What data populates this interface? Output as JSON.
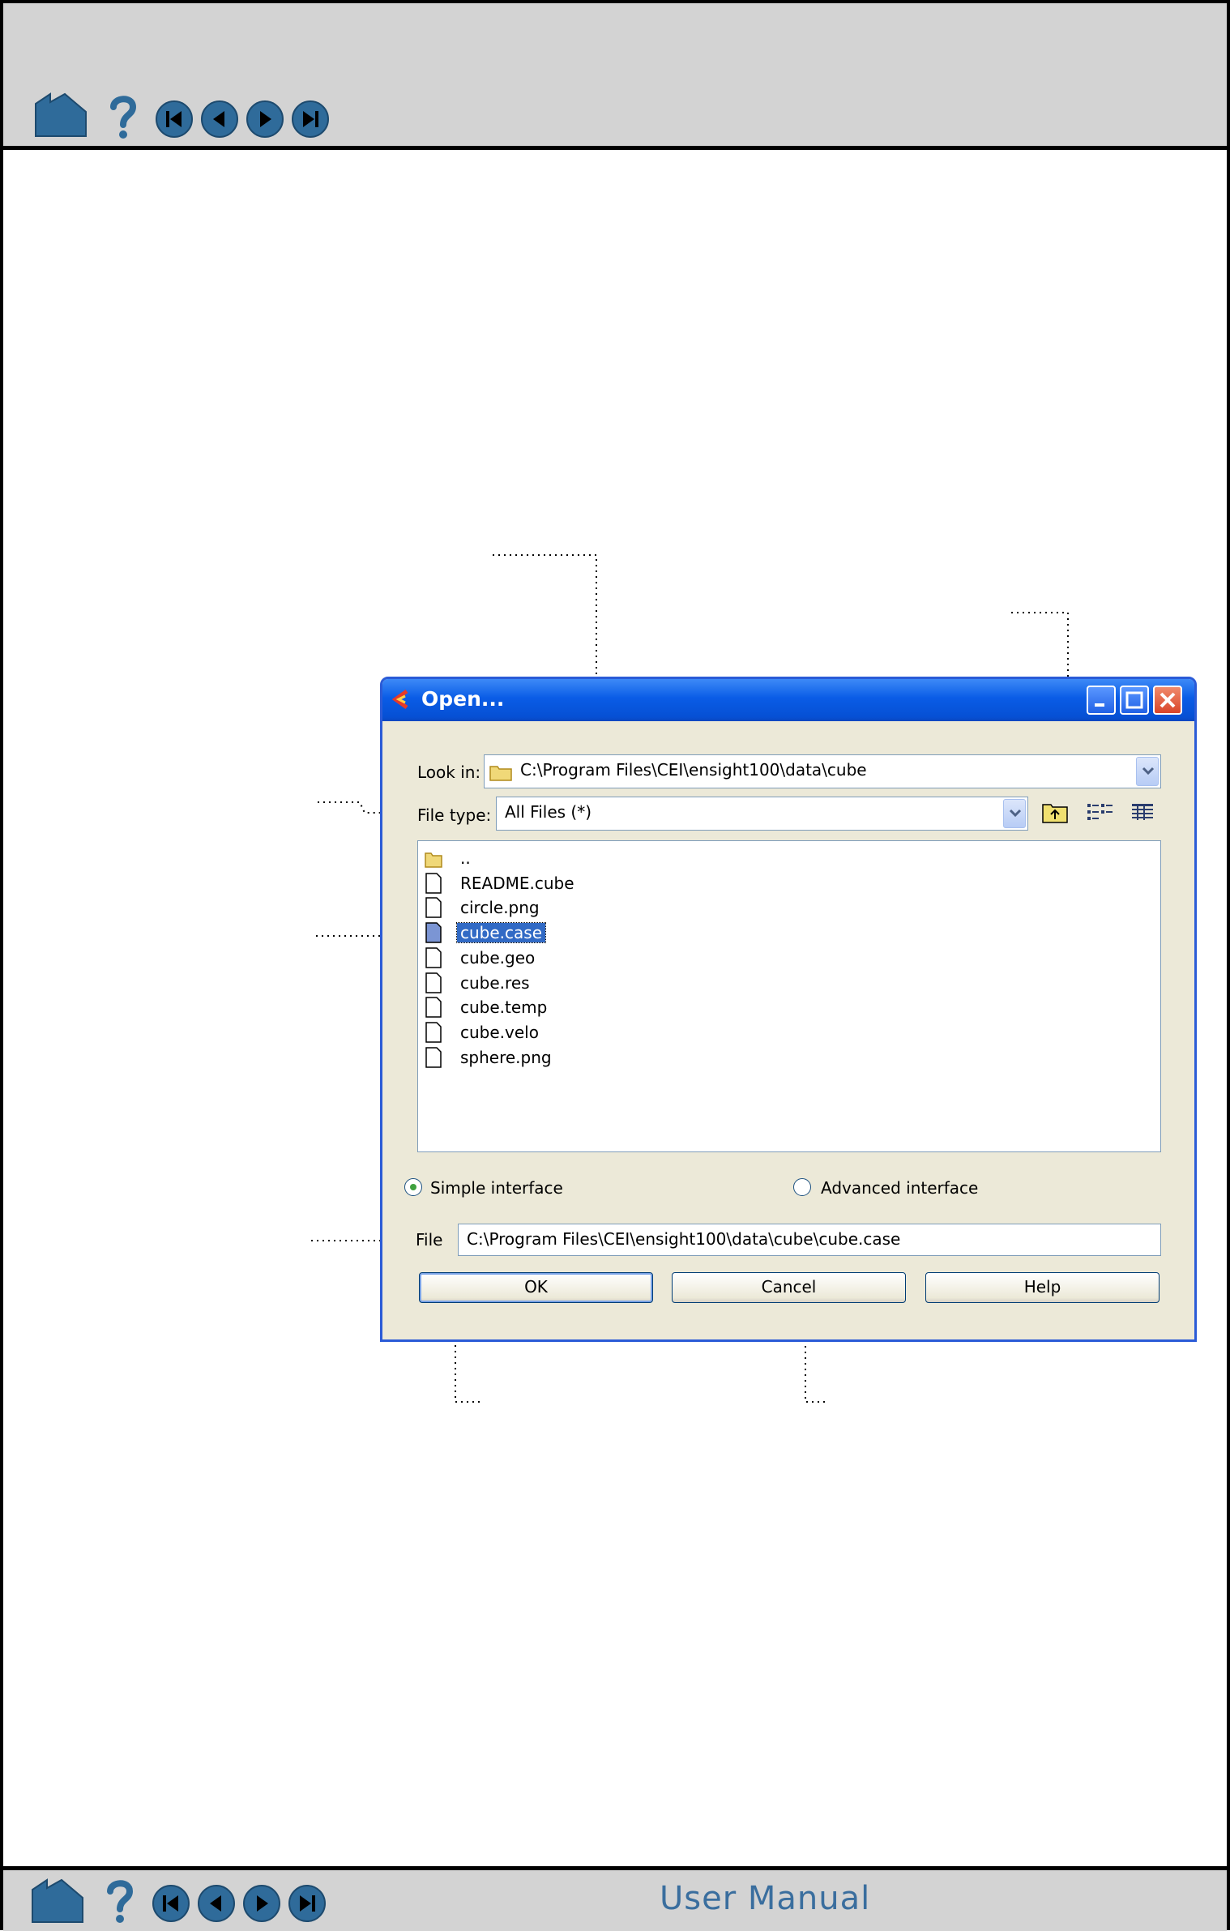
{
  "footer": {
    "manual_title": "User Manual"
  },
  "nav_icons": [
    "home-icon",
    "help-icon",
    "first-page-icon",
    "previous-page-icon",
    "next-page-icon",
    "last-page-icon"
  ],
  "dialog": {
    "title": "Open...",
    "look_in_label": "Look in:",
    "look_in_value": "C:\\Program Files\\CEI\\ensight100\\data\\cube",
    "file_type_label": "File type:",
    "file_type_value": "All Files (*)",
    "files": [
      {
        "name": "..",
        "type": "folder"
      },
      {
        "name": "README.cube",
        "type": "file"
      },
      {
        "name": "circle.png",
        "type": "file"
      },
      {
        "name": "cube.case",
        "type": "file",
        "selected": true
      },
      {
        "name": "cube.geo",
        "type": "file"
      },
      {
        "name": "cube.res",
        "type": "file"
      },
      {
        "name": "cube.temp",
        "type": "file"
      },
      {
        "name": "cube.velo",
        "type": "file"
      },
      {
        "name": "sphere.png",
        "type": "file"
      }
    ],
    "simple_interface_label": "Simple interface",
    "advanced_interface_label": "Advanced interface",
    "interface_selected": "Simple interface",
    "file_label": "File",
    "file_value": "C:\\Program Files\\CEI\\ensight100\\data\\cube\\cube.case",
    "ok_label": "OK",
    "cancel_label": "Cancel",
    "help_label": "Help"
  },
  "colors": {
    "nav_blue": "#2f6b9a",
    "title_blue": "#0a5ce6",
    "selection": "#316ac5",
    "dialog_bg": "#ece9d8"
  }
}
